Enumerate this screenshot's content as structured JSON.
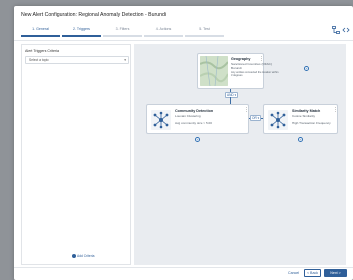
{
  "window": {
    "title": "New Alert Configuration: Regional Anomaly Detection - Burundi"
  },
  "steps": [
    {
      "label": "1. General",
      "state": "done"
    },
    {
      "label": "2. Triggers",
      "state": "active"
    },
    {
      "label": "3. Filters",
      "state": "pending"
    },
    {
      "label": "4. Actions",
      "state": "pending"
    },
    {
      "label": "5. Test",
      "state": "pending"
    }
  ],
  "toolbar": {
    "icon1": "layout-icon",
    "icon2": "code-icon"
  },
  "panel": {
    "title": "Alert Triggers Criteria",
    "select_value": "Select a topic",
    "add_label": "Add Criteria"
  },
  "nodes": {
    "geography": {
      "title": "Geography",
      "line1": "Sanctioned Countries (OFAC)",
      "line2": "Burundi",
      "line3": "Any entities connected the location within",
      "line4": "3 degrees"
    },
    "community": {
      "title": "Community Detection",
      "line1": "Louvain Clustering",
      "line2": "Avg community size > 5.00"
    },
    "similarity": {
      "title": "Similarity Match",
      "line1": "Cosine Similarity",
      "line2": "High Transaction Frequency"
    }
  },
  "operators": {
    "and": "AND ▾",
    "or": "OR ▾"
  },
  "footer": {
    "cancel": "Cancel",
    "back": "< Back",
    "next": "Next >"
  },
  "colors": {
    "accent": "#2f5f99",
    "canvas": "#e9ecf0"
  }
}
